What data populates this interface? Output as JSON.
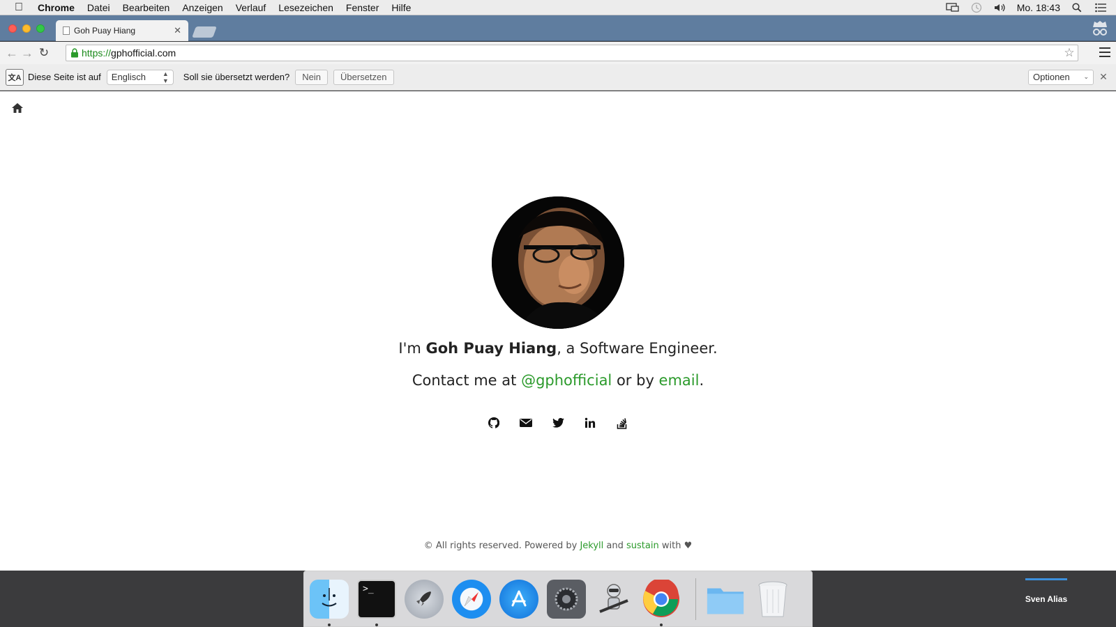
{
  "menubar": {
    "app": "Chrome",
    "items": [
      "Datei",
      "Bearbeiten",
      "Anzeigen",
      "Verlauf",
      "Lesezeichen",
      "Fenster",
      "Hilfe"
    ],
    "clock": "Mo. 18:43",
    "status_icons": [
      "display-icon",
      "time-machine-icon",
      "volume-icon",
      "spotlight-icon",
      "notification-center-icon"
    ]
  },
  "browser": {
    "tab_title": "Goh Puay Hiang",
    "url_scheme": "https://",
    "url_host": "gphofficial.com"
  },
  "translate_bar": {
    "prefix": "Diese Seite ist auf",
    "language": "Englisch",
    "question": "Soll sie übersetzt werden?",
    "no_button": "Nein",
    "translate_button": "Übersetzen",
    "options": "Optionen"
  },
  "page": {
    "intro_pre": "I'm ",
    "name": "Goh Puay Hiang",
    "intro_post": ", a Software Engineer.",
    "contact_pre": "Contact me at ",
    "handle": "@gphofficial",
    "contact_mid": " or by ",
    "email_link": "email",
    "contact_post": ".",
    "social": [
      "github-icon",
      "envelope-icon",
      "twitter-icon",
      "linkedin-icon",
      "stackoverflow-icon"
    ],
    "footer_pre": "© All rights reserved. Powered by ",
    "jekyll": "Jekyll",
    "footer_and": " and ",
    "sustain": "sustain",
    "footer_with": " with ",
    "heart": "♥"
  },
  "dock": {
    "apps": [
      "Finder",
      "Terminal",
      "Launchpad",
      "Safari",
      "App Store",
      "System Preferences",
      "Automator",
      "Chrome",
      "Folder",
      "Trash"
    ]
  },
  "desktop": {
    "alias_label": "Sven Alias"
  },
  "colors": {
    "link_green": "#2b9a2b",
    "tabstrip": "#5f7d9f"
  }
}
